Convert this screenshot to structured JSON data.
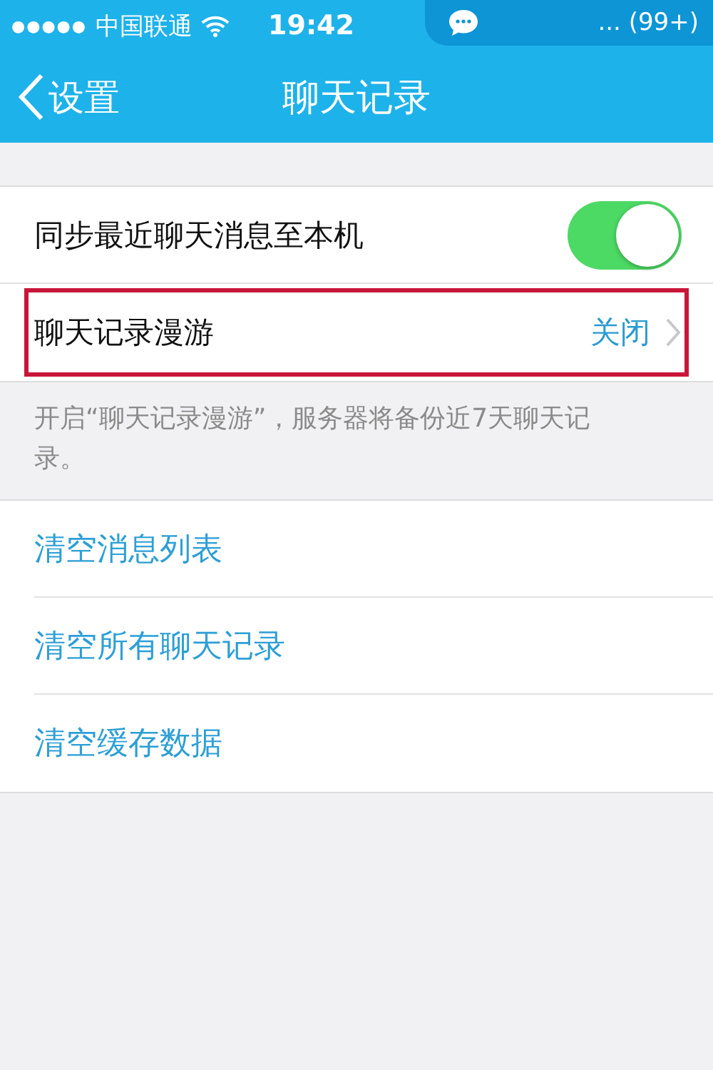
{
  "status_bar": {
    "signal_dots": "●●●●●",
    "carrier": "中国联通",
    "time": "19:42",
    "notice": "... (99+)"
  },
  "nav": {
    "back": "设置",
    "title": "聊天记录"
  },
  "settings": [
    {
      "kind": "toggle",
      "label": "同步最近聊天消息至本机",
      "on": true,
      "highlighted": false
    },
    {
      "kind": "value",
      "label": "聊天记录漫游",
      "value": "关闭",
      "highlighted": true
    }
  ],
  "note": "开启“聊天记录漫游”，服务器将备份近7天聊天记录。",
  "actions": [
    "清空消息列表",
    "清空所有聊天记录",
    "清空缓存数据"
  ]
}
